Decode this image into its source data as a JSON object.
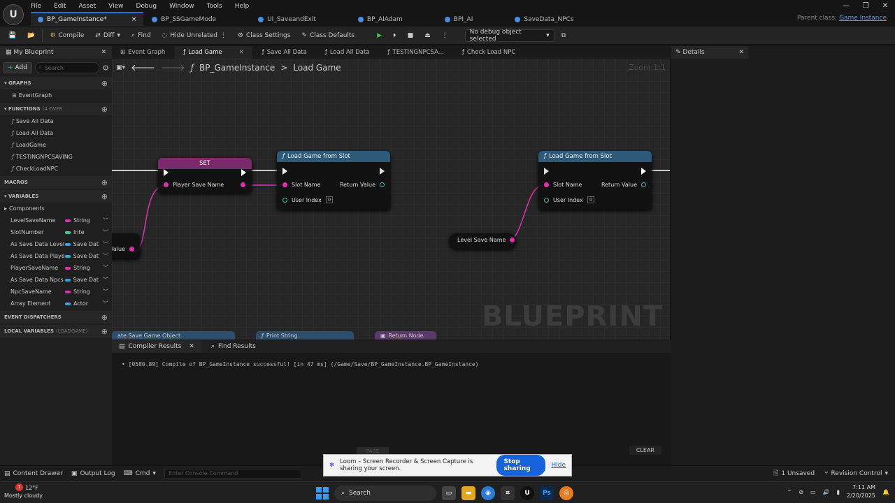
{
  "menu": [
    "File",
    "Edit",
    "Asset",
    "View",
    "Debug",
    "Window",
    "Tools",
    "Help"
  ],
  "doc_tabs": [
    {
      "label": "BP_GameInstance*",
      "color": "#4a8ee8",
      "active": true,
      "close": "×"
    },
    {
      "label": "BP_SSGameMode",
      "color": "#4a8ee8"
    },
    {
      "label": "UI_SaveandExit",
      "color": "#4a8ee8"
    },
    {
      "label": "BP_AIAdam",
      "color": "#4a8ee8"
    },
    {
      "label": "BPI_AI",
      "color": "#4a8ee8"
    },
    {
      "label": "SaveData_NPCs",
      "color": "#4a8ee8"
    }
  ],
  "parent_class": {
    "label": "Parent class:",
    "value": "Game Instance"
  },
  "toolbar": {
    "compile": "Compile",
    "diff": "Diff",
    "find": "Find",
    "hide_unrelated": "Hide Unrelated",
    "class_settings": "Class Settings",
    "class_defaults": "Class Defaults",
    "debug_object": "No debug object selected"
  },
  "left_panel": {
    "tab": "My Blueprint",
    "add": "Add",
    "search_placeholder": "Search",
    "graphs_header": "GRAPHS",
    "graphs": [
      "EventGraph"
    ],
    "functions_header": "FUNCTIONS",
    "functions_note": "(4 OVER",
    "functions": [
      "Save All Data",
      "Load All Data",
      "LoadGame",
      "TESTINGNPCSAVING",
      "CheckLoadNPC"
    ],
    "macros_header": "MACROS",
    "variables_header": "VARIABLES",
    "components": "Components",
    "variables": [
      {
        "name": "LevelSaveName",
        "type": "String",
        "color": "#e030b0"
      },
      {
        "name": "SlotNumber",
        "type": "Inte",
        "color": "#3fd08f"
      },
      {
        "name": "As Save Data Level",
        "type": "Save Dat",
        "color": "#2aa8e0"
      },
      {
        "name": "As Save Data Playe",
        "type": "Save Dat",
        "color": "#2aa8e0"
      },
      {
        "name": "PlayerSaveName",
        "type": "String",
        "color": "#e030b0"
      },
      {
        "name": "As Save Data Npcs",
        "type": "Save Dat",
        "color": "#2aa8e0"
      },
      {
        "name": "NpcSaveName",
        "type": "String",
        "color": "#e030b0"
      },
      {
        "name": "Array Element",
        "type": "Actor",
        "color": "#2aa8e0"
      }
    ],
    "event_dispatchers_header": "EVENT DISPATCHERS",
    "local_vars_header": "LOCAL VARIABLES",
    "local_vars_note": "(LOADGAME)"
  },
  "graph_tabs": [
    "Event Graph",
    "Load Game",
    "Save All Data",
    "Load All Data",
    "TESTINGNPCSA...",
    "Check Load NPC"
  ],
  "graph": {
    "breadcrumb_root": "BP_GameInstance",
    "breadcrumb_sep": ">",
    "breadcrumb_leaf": "Load Game",
    "zoom": "Zoom 1:1",
    "watermark": "BLUEPRINT",
    "set_node": {
      "title": "SET",
      "pin": "Player Save Name"
    },
    "load_node": {
      "title": "Load Game from Slot",
      "slot": "Slot Name",
      "ret": "Return Value",
      "user": "User Index",
      "idx": "0"
    },
    "var_node": "Level Save Name",
    "partial_value": "Value",
    "bottom_nodes": [
      "ate Save Game Object",
      "Print String",
      "Return Node"
    ]
  },
  "bottom": {
    "tabs": [
      "Compiler Results",
      "Find Results"
    ],
    "log": "[0580.89] Compile of BP_GameInstance successful! [in 47 ms] (/Game/Save/BP_GameInstance.BP_GameInstance)",
    "page": "PAGE",
    "clear": "CLEAR"
  },
  "details": {
    "tab": "Details"
  },
  "status": {
    "content_drawer": "Content Drawer",
    "output_log": "Output Log",
    "cmd": "Cmd",
    "console_placeholder": "Enter Console Command",
    "unsaved": "1 Unsaved",
    "revision": "Revision Control"
  },
  "loom": {
    "text": "Loom – Screen Recorder & Screen Capture is sharing your screen.",
    "stop": "Stop sharing",
    "hide": "Hide"
  },
  "taskbar": {
    "temp": "12°F",
    "weather": "Mostly cloudy",
    "badge": "1",
    "search": "Search",
    "time": "7:11 AM",
    "date": "2/20/2025"
  }
}
